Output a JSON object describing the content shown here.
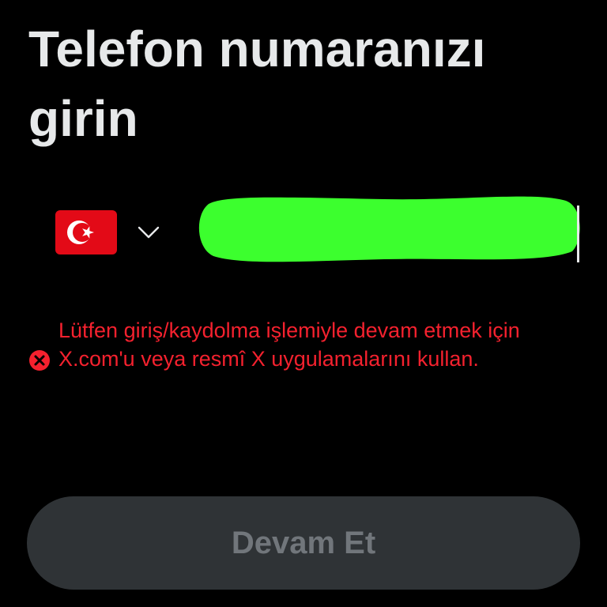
{
  "page": {
    "title": "Telefon numaranızı girin"
  },
  "phone": {
    "country_flag_icon": "turkey-flag-icon",
    "country_selector_icon": "chevron-down-icon",
    "input_value": "",
    "redacted": true
  },
  "error": {
    "icon": "error-x-circle-icon",
    "message": "Lütfen giriş/kaydolma işlemiyle devam etmek için X.com'u veya resmî X uygulamalarını kullan."
  },
  "actions": {
    "continue_label": "Devam Et",
    "continue_disabled": true
  },
  "colors": {
    "background": "#000000",
    "text": "#e7e9ea",
    "error": "#f4212e",
    "button_bg": "#2f3336",
    "button_text": "#71767b",
    "redaction": "#3cff2e"
  }
}
